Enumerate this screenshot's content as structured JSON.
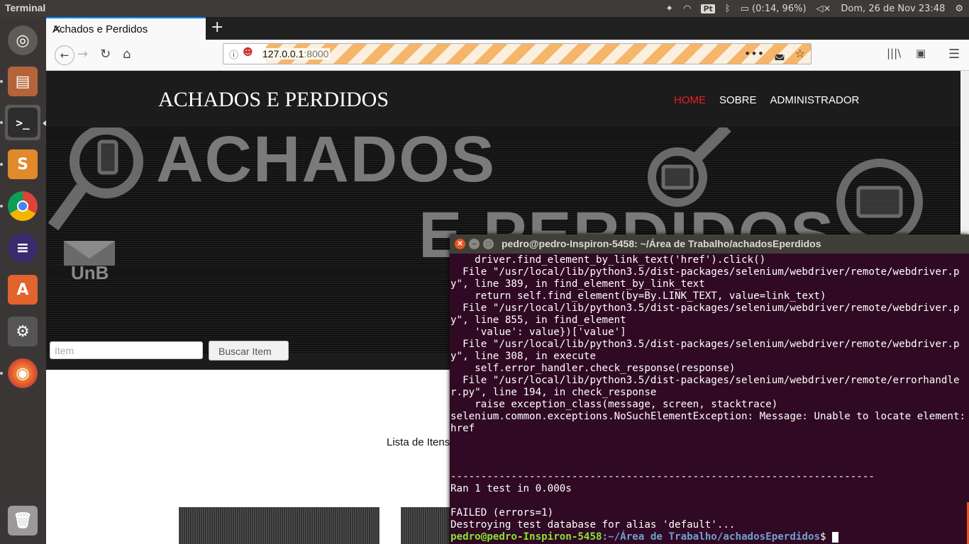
{
  "topbar": {
    "app_name": "Terminal",
    "battery": "(0:14, 96%)",
    "keyboard": "Pt",
    "datetime": "Dom, 26 de Nov 23:48"
  },
  "launcher": {
    "items": [
      "ubuntu-dash",
      "files",
      "terminal",
      "sublime-text",
      "chrome",
      "eclipse",
      "software-center",
      "system-settings",
      "firefox",
      "trash"
    ]
  },
  "browser": {
    "tab_title": "Achados e Perdidos",
    "url_host": "127.0.0.1",
    "url_port": ":8000"
  },
  "site": {
    "brand": "ACHADOS E PERDIDOS",
    "menu": [
      "HOME",
      "SOBRE",
      "ADMINISTRADOR"
    ],
    "hero_line1": "ACHADOS",
    "hero_line2": "E PERDIDOS",
    "hero_logo": "UnB",
    "search_placeholder": "Item",
    "search_button": "Buscar Item",
    "list_title": "Lista de Itens"
  },
  "terminal": {
    "title": "pedro@pedro-Inspiron-5458: ~/Área de Trabalho/achadosEperdidos",
    "output": "    driver.find_element_by_link_text('href').click()\n  File \"/usr/local/lib/python3.5/dist-packages/selenium/webdriver/remote/webdriver.py\", line 389, in find_element_by_link_text\n    return self.find_element(by=By.LINK_TEXT, value=link_text)\n  File \"/usr/local/lib/python3.5/dist-packages/selenium/webdriver/remote/webdriver.py\", line 855, in find_element\n    'value': value})['value']\n  File \"/usr/local/lib/python3.5/dist-packages/selenium/webdriver/remote/webdriver.py\", line 308, in execute\n    self.error_handler.check_response(response)\n  File \"/usr/local/lib/python3.5/dist-packages/selenium/webdriver/remote/errorhandler.py\", line 194, in check_response\n    raise exception_class(message, screen, stacktrace)\nselenium.common.exceptions.NoSuchElementException: Message: Unable to locate element: href\n\n\n\n----------------------------------------------------------------------\nRan 1 test in 0.000s\n\nFAILED (errors=1)\nDestroying test database for alias 'default'...\n",
    "prompt_user": "pedro@pedro-Inspiron-5458",
    "prompt_path": ":~/Área de Trabalho/achadosEperdidos",
    "prompt_symbol": "$ "
  }
}
